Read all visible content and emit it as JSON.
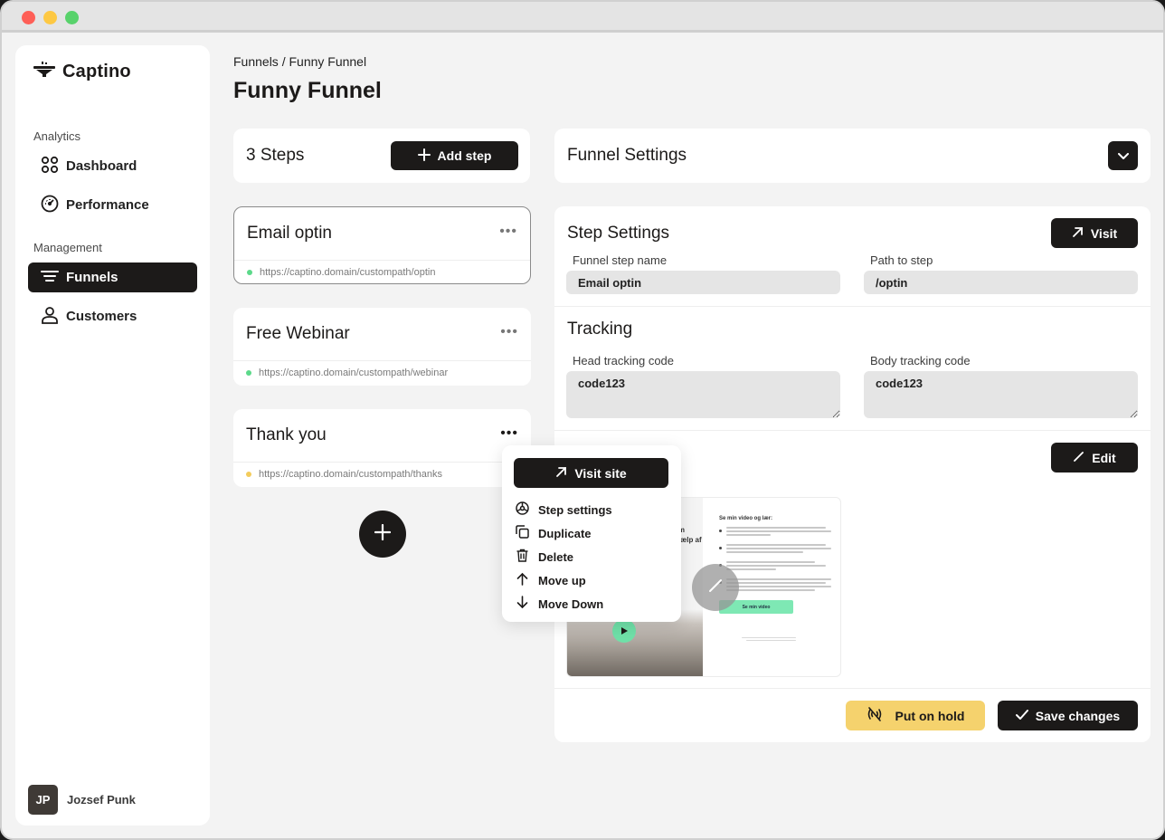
{
  "app": {
    "brand": "Captino"
  },
  "sidebar": {
    "sections": [
      {
        "label": "Analytics",
        "items": [
          {
            "label": "Dashboard",
            "icon": "grid-icon"
          },
          {
            "label": "Performance",
            "icon": "gauge-icon"
          }
        ]
      },
      {
        "label": "Management",
        "items": [
          {
            "label": "Funnels",
            "icon": "funnel-lines-icon",
            "active": true
          },
          {
            "label": "Customers",
            "icon": "user-icon"
          }
        ]
      }
    ],
    "user": {
      "initials": "JP",
      "name": "Jozsef Punk"
    }
  },
  "header": {
    "breadcrumb": "Funnels / Funny Funnel",
    "title": "Funny Funnel"
  },
  "steps": {
    "count_label": "3 Steps",
    "add_label": "Add step",
    "items": [
      {
        "name": "Email optin",
        "url": "https://captino.domain/custompath/optin",
        "status_color": "#5cd98a",
        "selected": true
      },
      {
        "name": "Free Webinar",
        "url": "https://captino.domain/custompath/webinar",
        "status_color": "#5cd98a"
      },
      {
        "name": "Thank you",
        "url": "https://captino.domain/custompath/thanks",
        "status_color": "#f3cc5c"
      }
    ]
  },
  "context_menu": {
    "visit_label": "Visit site",
    "items": [
      {
        "label": "Step settings",
        "icon": "settings-wheel-icon"
      },
      {
        "label": "Duplicate",
        "icon": "duplicate-icon"
      },
      {
        "label": "Delete",
        "icon": "trash-icon"
      },
      {
        "label": "Move up",
        "icon": "arrow-up-icon"
      },
      {
        "label": "Move Down",
        "icon": "arrow-down-icon"
      }
    ]
  },
  "funnel_settings": {
    "title": "Funnel Settings"
  },
  "step_settings": {
    "title": "Step Settings",
    "visit_label": "Visit",
    "name_label": "Funnel step name",
    "name_value": "Email optin",
    "path_label": "Path to step",
    "path_value": "/optin",
    "tracking_title": "Tracking",
    "head_label": "Head tracking code",
    "head_value": "code123",
    "body_label": "Body tracking code",
    "body_value": "code123",
    "edit_label": "Edit",
    "preview": {
      "left_text": "om\nhjælp af",
      "heading": "Se min video og lær:",
      "cta": "Se min video"
    },
    "hold_label": "Put on hold",
    "save_label": "Save changes"
  },
  "colors": {
    "dark": "#1c1a19",
    "hold": "#f5d26d",
    "status_green": "#5cd98a",
    "status_yellow": "#f3cc5c",
    "preview_cta": "#7ee8b4"
  }
}
